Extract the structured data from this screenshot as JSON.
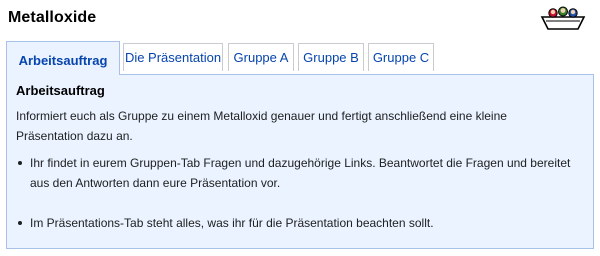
{
  "page": {
    "title": "Metalloxide"
  },
  "logo": {
    "icon": "group-boat-logo-icon"
  },
  "tabs": [
    {
      "label": "Arbeitsauftrag",
      "active": true
    },
    {
      "label": "Die Präsentation",
      "active": false
    },
    {
      "label": "Gruppe A",
      "active": false
    },
    {
      "label": "Gruppe B",
      "active": false
    },
    {
      "label": "Gruppe C",
      "active": false
    }
  ],
  "panel": {
    "heading": "Arbeitsauftrag",
    "intro": "Informiert euch als Gruppe zu einem Metalloxid genauer und fertigt anschließend eine kleine Präsentation dazu an.",
    "bullets": [
      "Ihr findet in eurem Gruppen-Tab Fragen und dazugehörige Links. Beantwortet die Fragen und bereitet aus den Antworten dann eure Präsentation vor.",
      "Im Präsentations-Tab steht alles, was ihr für die Präsentation beachten sollt."
    ]
  },
  "colors": {
    "link": "#0645ad",
    "panel_background": "#eaf3ff",
    "panel_border": "#a7c2e6",
    "tab_border": "#c8ccd1"
  }
}
